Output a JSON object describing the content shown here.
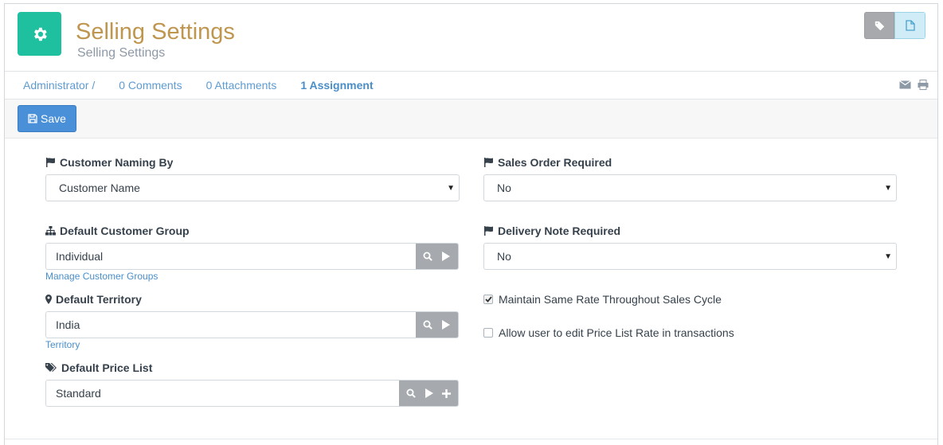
{
  "header": {
    "title": "Selling Settings",
    "subtitle": "Selling Settings",
    "icon": "gear-icon",
    "icon_bg": "#1fc0a0",
    "title_color": "#bf9650"
  },
  "meta": {
    "owner": "Administrator /",
    "comments": "0 Comments",
    "attachments": "0 Attachments",
    "assignment": "1 Assignment"
  },
  "toolbar": {
    "save_label": "Save",
    "save_color": "#4a90d9"
  },
  "fields": {
    "customer_naming": {
      "label": "Customer Naming By",
      "value": "Customer Name",
      "icon": "flag-icon"
    },
    "customer_group": {
      "label": "Default Customer Group",
      "value": "Individual",
      "help": "Manage Customer Groups",
      "icon": "sitemap-icon"
    },
    "territory": {
      "label": "Default Territory",
      "value": "India",
      "help": "Territory",
      "icon": "map-marker-icon"
    },
    "price_list": {
      "label": "Default Price List",
      "value": "Standard",
      "icon": "tags-icon"
    },
    "so_required": {
      "label": "Sales Order Required",
      "value": "No",
      "icon": "flag-icon"
    },
    "dn_required": {
      "label": "Delivery Note Required",
      "value": "No",
      "icon": "flag-icon"
    },
    "maintain_rate": {
      "label": "Maintain Same Rate Throughout Sales Cycle",
      "checked": true
    },
    "allow_edit_rate": {
      "label": "Allow user to edit Price List Rate in transactions",
      "checked": false
    }
  }
}
